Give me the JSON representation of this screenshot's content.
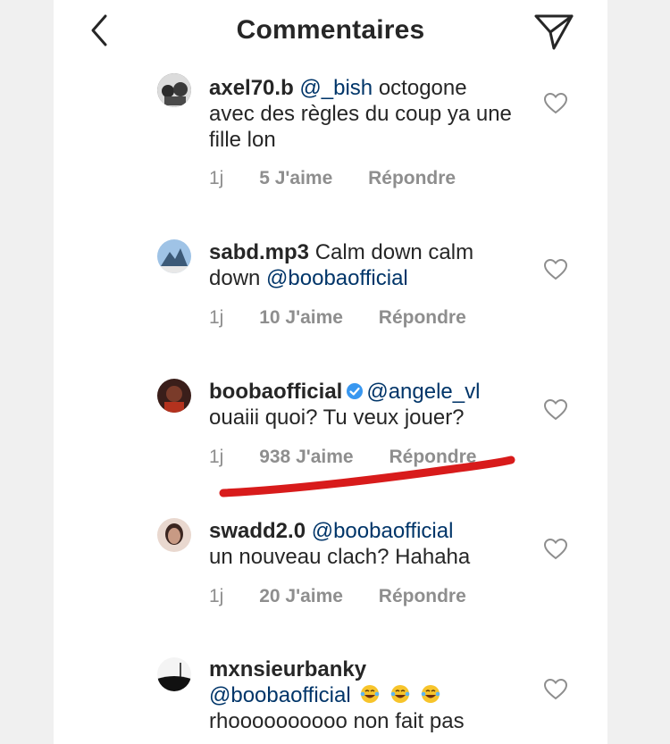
{
  "header": {
    "title": "Commentaires",
    "back_icon": "chevron-left-icon",
    "send_icon": "paper-plane-icon"
  },
  "colors": {
    "text": "#262626",
    "mention": "#003569",
    "meta": "#8e8e8e",
    "verified": "#3897f0",
    "annotation": "#d81b1b"
  },
  "comments": [
    {
      "username": "axel70.b",
      "mention": "@_bish",
      "text": "octogone avec des règles du coup ya une fille lon",
      "time": "1j",
      "likes": "5 J'aime",
      "reply": "Répondre"
    },
    {
      "username": "sabd.mp3",
      "text": "Calm down calm down",
      "mention": "@boobaofficial",
      "time": "1j",
      "likes": "10 J'aime",
      "reply": "Répondre"
    },
    {
      "username": "boobaofficial",
      "verified": true,
      "mention": "@angele_vl",
      "text": "ouaiii quoi? Tu veux jouer?",
      "time": "1j",
      "likes": "938 J'aime",
      "reply": "Répondre"
    },
    {
      "username": "swadd2.0",
      "mention": "@boobaofficial",
      "text": "un nouveau clach? Hahaha",
      "time": "1j",
      "likes": "20 J'aime",
      "reply": "Répondre"
    },
    {
      "username": "mxnsieurbanky",
      "mention": "@boobaofficial",
      "emoji_count": 3,
      "text": "rhoooooooooo non fait pas",
      "emoji": "tears-of-joy-emoji"
    }
  ]
}
